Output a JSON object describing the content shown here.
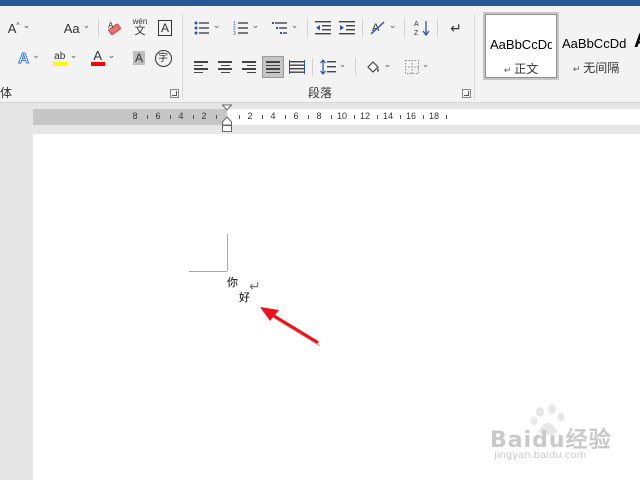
{
  "ribbon": {
    "font_group": {
      "label": "字体",
      "grow_font": "A",
      "shrink_font": "A",
      "change_case": "Aa",
      "phonetic_guide_top": "wén",
      "phonetic_guide_char": "文",
      "char_border": "A",
      "text_effects": "A",
      "highlight_letters": "ab",
      "font_color": "A",
      "char_shading": "A",
      "enclose_char": "字",
      "highlight_color": "#ffff00",
      "font_color_value": "#ff0000"
    },
    "paragraph_group": {
      "label": "段落"
    },
    "styles": [
      {
        "sample": "AaBbCcDd",
        "name": "正文",
        "selected": true
      },
      {
        "sample": "AaBbCcDd",
        "name": "无间隔",
        "selected": false
      }
    ],
    "styles_partial_glyph": "A"
  },
  "ruler": {
    "left_numbers": [
      "8",
      "6",
      "4",
      "2"
    ],
    "right_numbers": [
      "2",
      "4",
      "6",
      "8",
      "10",
      "12",
      "14",
      "16",
      "18"
    ]
  },
  "document": {
    "char1": "你",
    "char2": "好",
    "paragraph_mark": "↵"
  },
  "watermark": {
    "brand": "Baidu经验",
    "url": "jingyan.baidu.com"
  },
  "colors": {
    "title_bar": "#2b579a",
    "annotation_arrow": "#e8141b"
  }
}
